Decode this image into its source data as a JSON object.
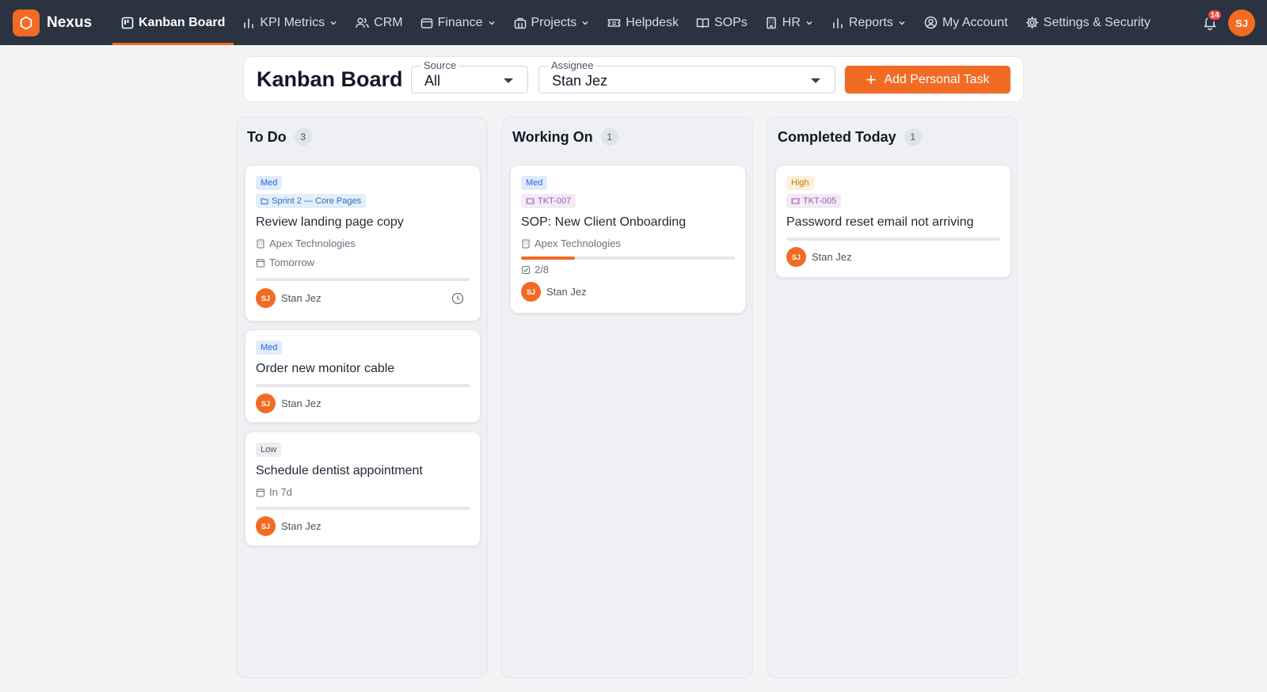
{
  "app": {
    "name": "Nexus"
  },
  "nav": {
    "items": [
      {
        "label": "Kanban Board",
        "icon": "kanban-icon",
        "active": true
      },
      {
        "label": "KPI Metrics",
        "icon": "bar-chart-icon",
        "dropdown": true
      },
      {
        "label": "CRM",
        "icon": "users-icon"
      },
      {
        "label": "Finance",
        "icon": "wallet-icon",
        "dropdown": true
      },
      {
        "label": "Projects",
        "icon": "briefcase-icon",
        "dropdown": true
      },
      {
        "label": "Helpdesk",
        "icon": "ticket-icon"
      },
      {
        "label": "SOPs",
        "icon": "book-icon"
      },
      {
        "label": "HR",
        "icon": "building-icon",
        "dropdown": true
      },
      {
        "label": "Reports",
        "icon": "bar-chart-icon",
        "dropdown": true
      },
      {
        "label": "My Account",
        "icon": "user-circle-icon"
      },
      {
        "label": "Settings & Security",
        "icon": "gear-icon"
      }
    ],
    "notifications": "14",
    "user_initials": "SJ"
  },
  "header": {
    "title": "Kanban Board",
    "source": {
      "label": "Source",
      "value": "All"
    },
    "assignee": {
      "label": "Assignee",
      "value": "Stan Jez"
    },
    "add_button": "Add Personal Task"
  },
  "columns": [
    {
      "title": "To Do",
      "count": "3",
      "cards": [
        {
          "priority": "Med",
          "tag": "Sprint 2 — Core Pages",
          "title": "Review landing page copy",
          "client": "Apex Technologies",
          "due": "Tomorrow",
          "assignee": "Stan Jez",
          "initials": "SJ"
        },
        {
          "priority": "Med",
          "title": "Order new monitor cable",
          "assignee": "Stan Jez",
          "initials": "SJ"
        },
        {
          "priority": "Low",
          "title": "Schedule dentist appointment",
          "due": "In 7d",
          "assignee": "Stan Jez",
          "initials": "SJ"
        }
      ]
    },
    {
      "title": "Working On",
      "count": "1",
      "cards": [
        {
          "priority": "Med",
          "tag": "TKT-007",
          "title": "SOP: New Client Onboarding",
          "client": "Apex Technologies",
          "progress": 0.25,
          "checklist": "2/8",
          "assignee": "Stan Jez",
          "initials": "SJ"
        }
      ]
    },
    {
      "title": "Completed Today",
      "count": "1",
      "cards": [
        {
          "priority": "High",
          "tag": "TKT-005",
          "title": "Password reset email not arriving",
          "assignee": "Stan Jez",
          "initials": "SJ"
        }
      ]
    }
  ],
  "colors": {
    "accent": "#f26b24",
    "nav_bg": "#2b3240",
    "page_bg": "#f3f4f6"
  }
}
